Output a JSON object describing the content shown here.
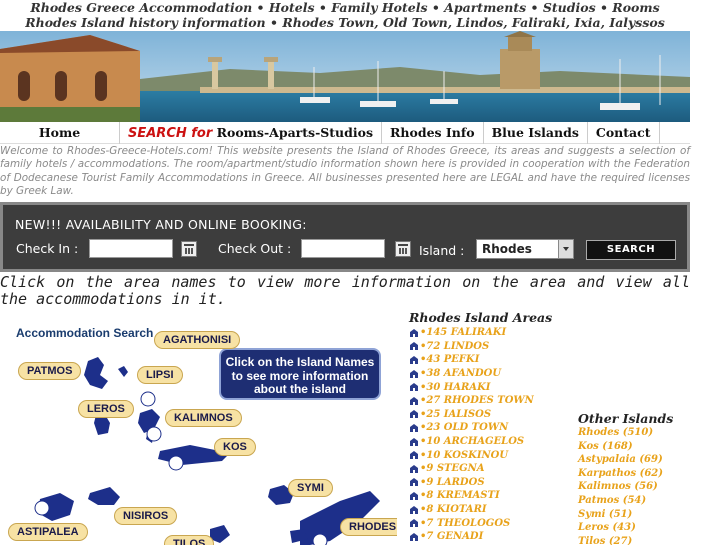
{
  "header": {
    "line1": "Rhodes Greece Accommodation • Hotels • Family Hotels • Apartments • Studios • Rooms",
    "line2": "Rhodes Island history information • Rhodes Town, Old Town, Lindos, Faliraki, Ixia, Ialyssos"
  },
  "nav": {
    "home": "Home",
    "search_prefix": "SEARCH for",
    "search_suffix": " Rooms-Aparts-Studios",
    "info": "Rhodes Info",
    "blue": "Blue Islands",
    "contact": "Contact"
  },
  "welcome_text": "Welcome to Rhodes-Greece-Hotels.com! This website presents the Island of Rhodes Greece, its areas and suggests a selection of family hotels / accommodations. The room/apartment/studio information shown here is provided in cooperation with the Federation of Dodecanese Tourist Family Accommodations in Greece. All businesses presented here are LEGAL and have the required licenses by Greek Law.",
  "booking": {
    "title": "NEW!!! AVAILABILITY AND ONLINE BOOKING:",
    "checkin_label": "Check In :",
    "checkout_label": "Check Out :",
    "island_label": "Island :",
    "island_value": "Rhodes",
    "search_button": "SEARCH"
  },
  "instruction": "Click on the area names to view more information on the area and view all the accommodations in it.",
  "map": {
    "title": "Accommodation Search",
    "callout": [
      "Click on the Island Names",
      "to see more information",
      "about the island"
    ],
    "islands": [
      "AGATHONISI",
      "PATMOS",
      "LIPSI",
      "LEROS",
      "KALIMNOS",
      "KOS",
      "SYMI",
      "NISIROS",
      "RHODES",
      "ASTIPALEA",
      "TILOS"
    ]
  },
  "areas": {
    "title": "Rhodes Island Areas",
    "items": [
      "•145 FALIRAKI",
      "•72 LINDOS",
      "•43 PEFKI",
      "•38 AFANDOU",
      "•30 HARAKI",
      "•27 RHODES TOWN",
      "•25 IALISOS",
      "•23 OLD TOWN",
      "•10 ARCHAGELOS",
      "•10 KOSKINOU",
      "•9 STEGNA",
      "•9 LARDOS",
      "•8 KREMASTI",
      "•8 KIOTARI",
      "•7 THEOLOGOS",
      "•7 GENADI"
    ]
  },
  "other_islands": {
    "title": "Other Islands",
    "items": [
      "Rhodes (510)",
      "Kos (168)",
      "Astypalaia (69)",
      "Karpathos (62)",
      "Kalimnos (56)",
      "Patmos (54)",
      "Symi (51)",
      "Leros (43)",
      "Tilos (27)"
    ]
  },
  "colors": {
    "link": "#e8a21a",
    "accent": "#cc1111",
    "booking_bg": "#3d3d3d",
    "map_label_bg": "#f7e2a4",
    "callout_bg": "#1e2e73"
  }
}
